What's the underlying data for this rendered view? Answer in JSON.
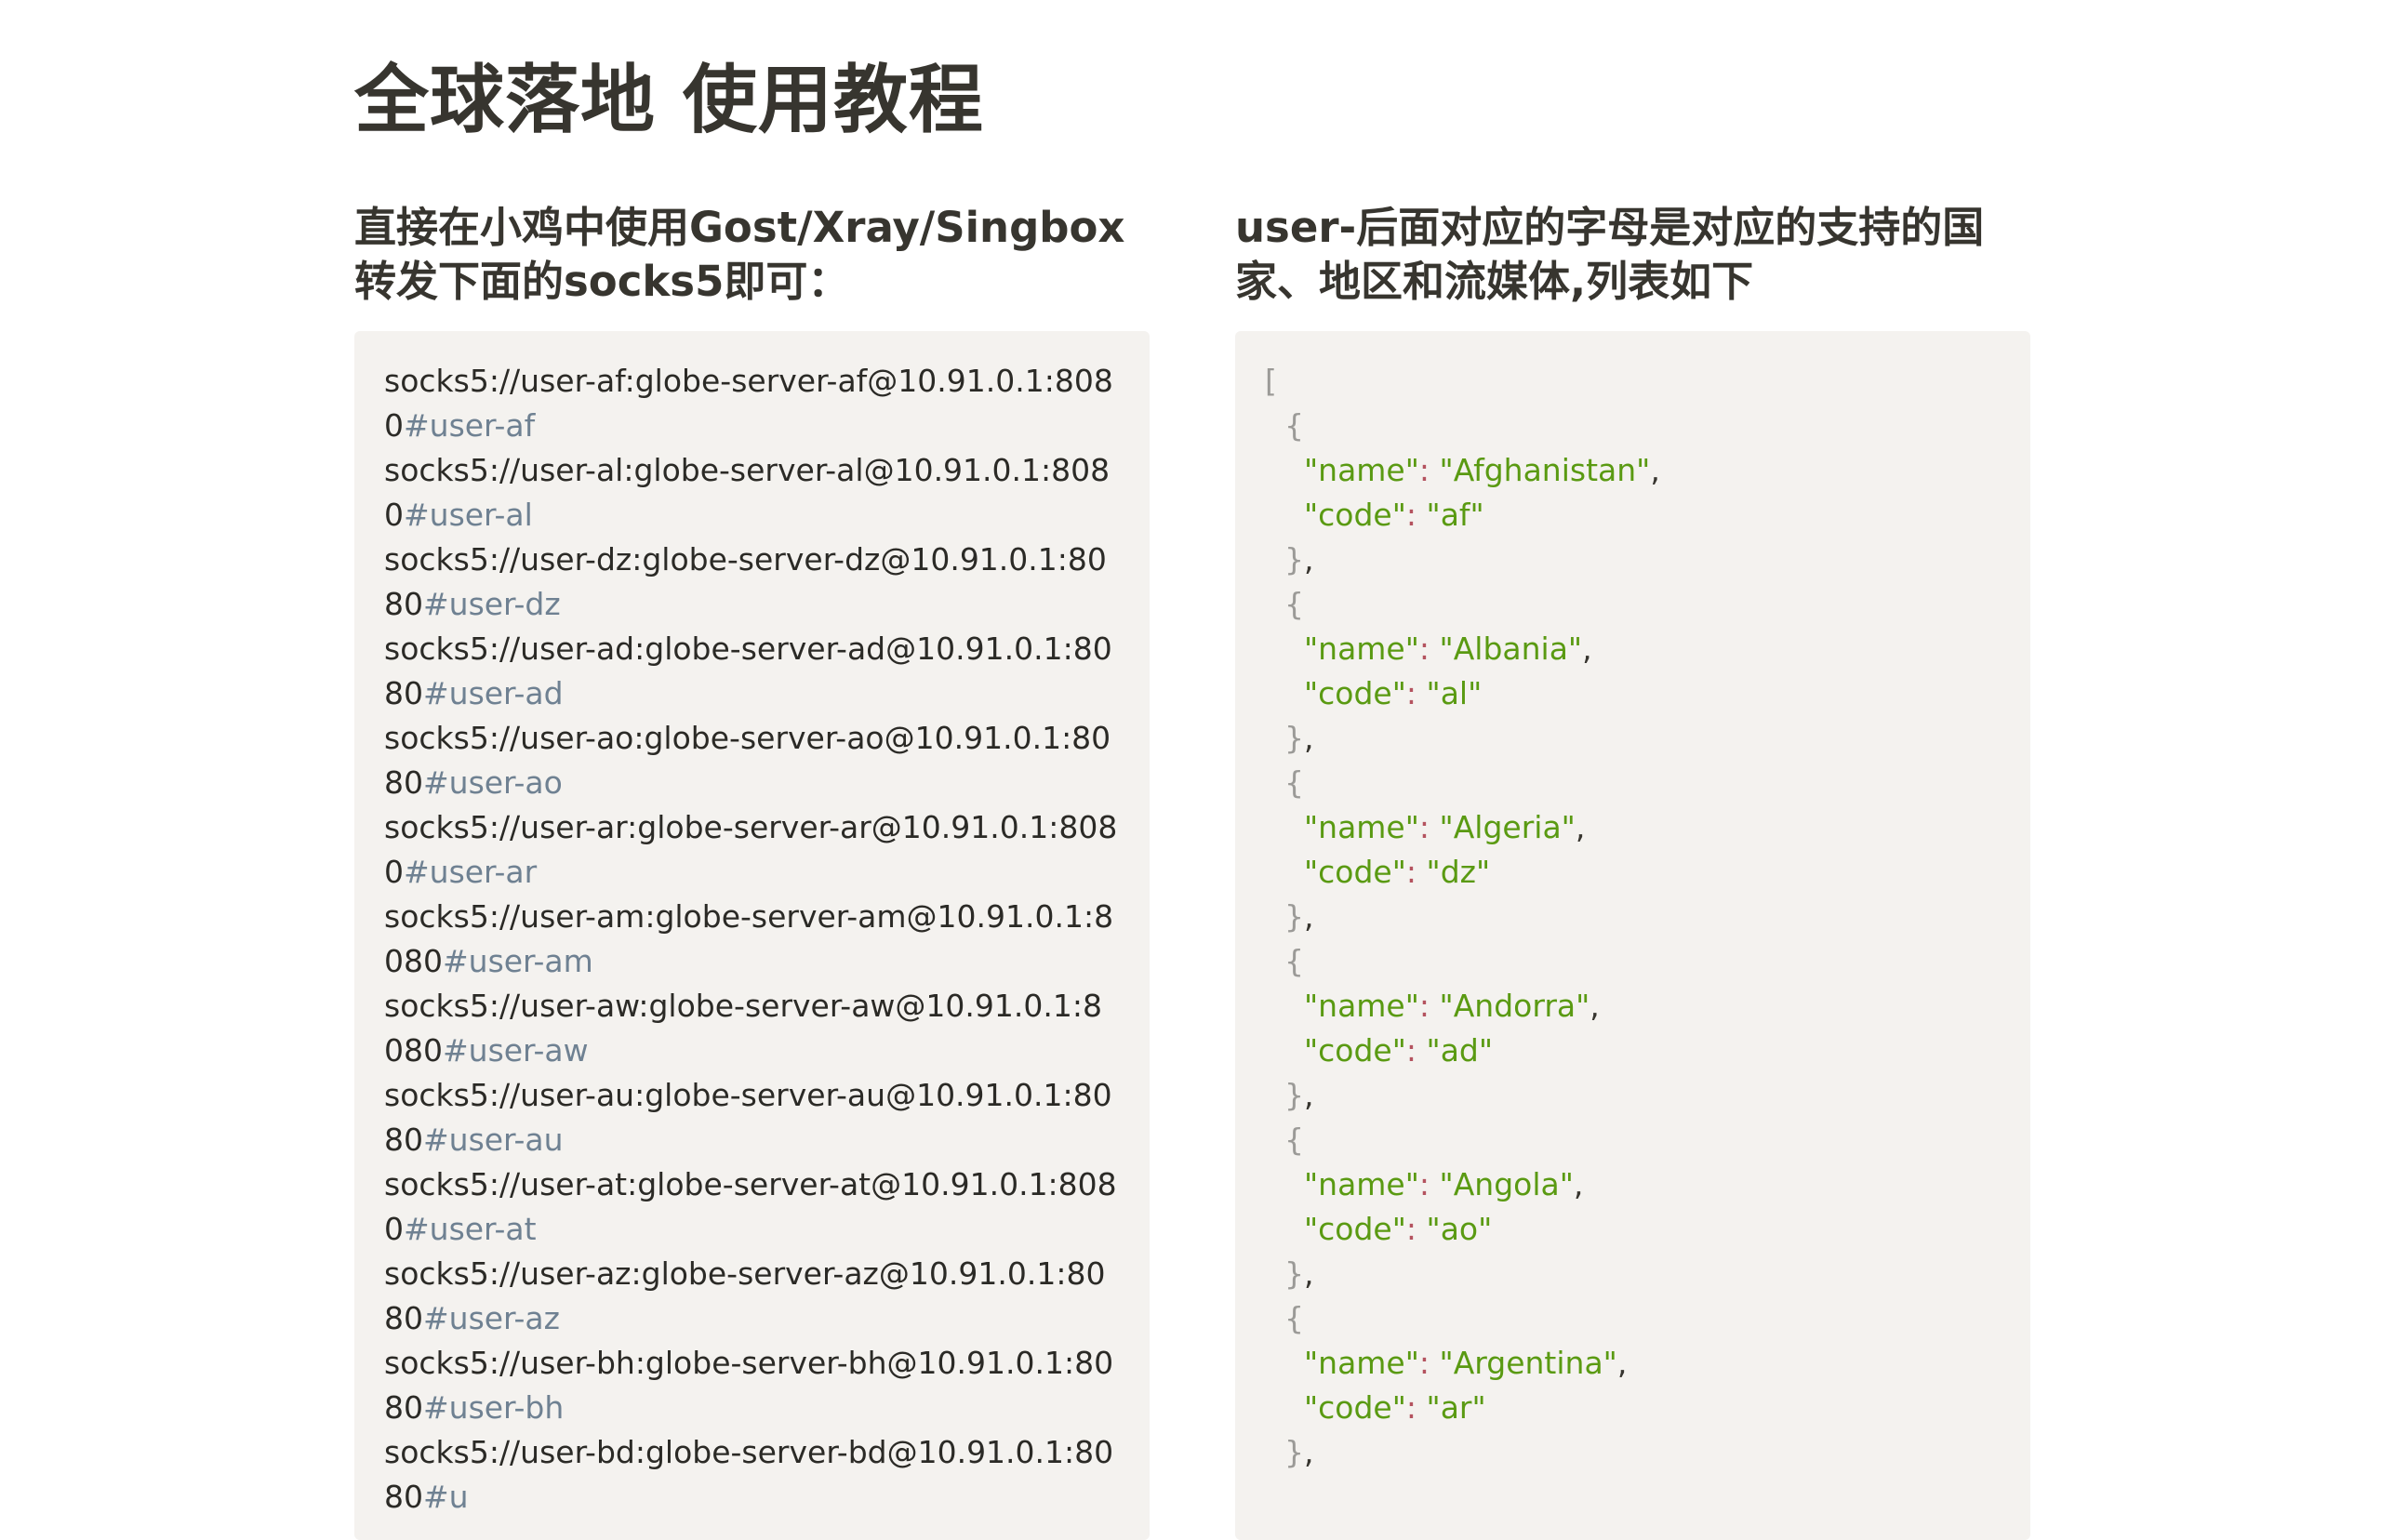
{
  "page": {
    "title": "全球落地 使用教程"
  },
  "left": {
    "heading": "直接在小鸡中使用Gost/Xray/Singbox转发下面的socks5即可：",
    "proxies": [
      {
        "url": "socks5://user-af:globe-server-af@10.91.0.1:8080",
        "tag": "#user-af"
      },
      {
        "url": "socks5://user-al:globe-server-al@10.91.0.1:8080",
        "tag": "#user-al"
      },
      {
        "url": "socks5://user-dz:globe-server-dz@10.91.0.1:8080",
        "tag": "#user-dz"
      },
      {
        "url": "socks5://user-ad:globe-server-ad@10.91.0.1:8080",
        "tag": "#user-ad"
      },
      {
        "url": "socks5://user-ao:globe-server-ao@10.91.0.1:8080",
        "tag": "#user-ao"
      },
      {
        "url": "socks5://user-ar:globe-server-ar@10.91.0.1:8080",
        "tag": "#user-ar"
      },
      {
        "url": "socks5://user-am:globe-server-am@10.91.0.1:8080",
        "tag": "#user-am"
      },
      {
        "url": "socks5://user-aw:globe-server-aw@10.91.0.1:8080",
        "tag": "#user-aw"
      },
      {
        "url": "socks5://user-au:globe-server-au@10.91.0.1:8080",
        "tag": "#user-au"
      },
      {
        "url": "socks5://user-at:globe-server-at@10.91.0.1:8080",
        "tag": "#user-at"
      },
      {
        "url": "socks5://user-az:globe-server-az@10.91.0.1:8080",
        "tag": "#user-az"
      },
      {
        "url": "socks5://user-bh:globe-server-bh@10.91.0.1:8080",
        "tag": "#user-bh"
      },
      {
        "url": "socks5://user-bd:globe-server-bd@10.91.0.1:8080",
        "tag": "#u"
      }
    ]
  },
  "right": {
    "heading": "user-后面对应的字母是对应的支持的国家、地区和流媒体,列表如下",
    "json": {
      "open_bracket": "[",
      "name_key": "\"name\"",
      "code_key": "\"code\"",
      "entries": [
        {
          "name": "\"Afghanistan\"",
          "code": "\"af\""
        },
        {
          "name": "\"Albania\"",
          "code": "\"al\""
        },
        {
          "name": "\"Algeria\"",
          "code": "\"dz\""
        },
        {
          "name": "\"Andorra\"",
          "code": "\"ad\""
        },
        {
          "name": "\"Angola\"",
          "code": "\"ao\""
        },
        {
          "name": "\"Argentina\"",
          "code": "\"ar\""
        }
      ]
    }
  }
}
